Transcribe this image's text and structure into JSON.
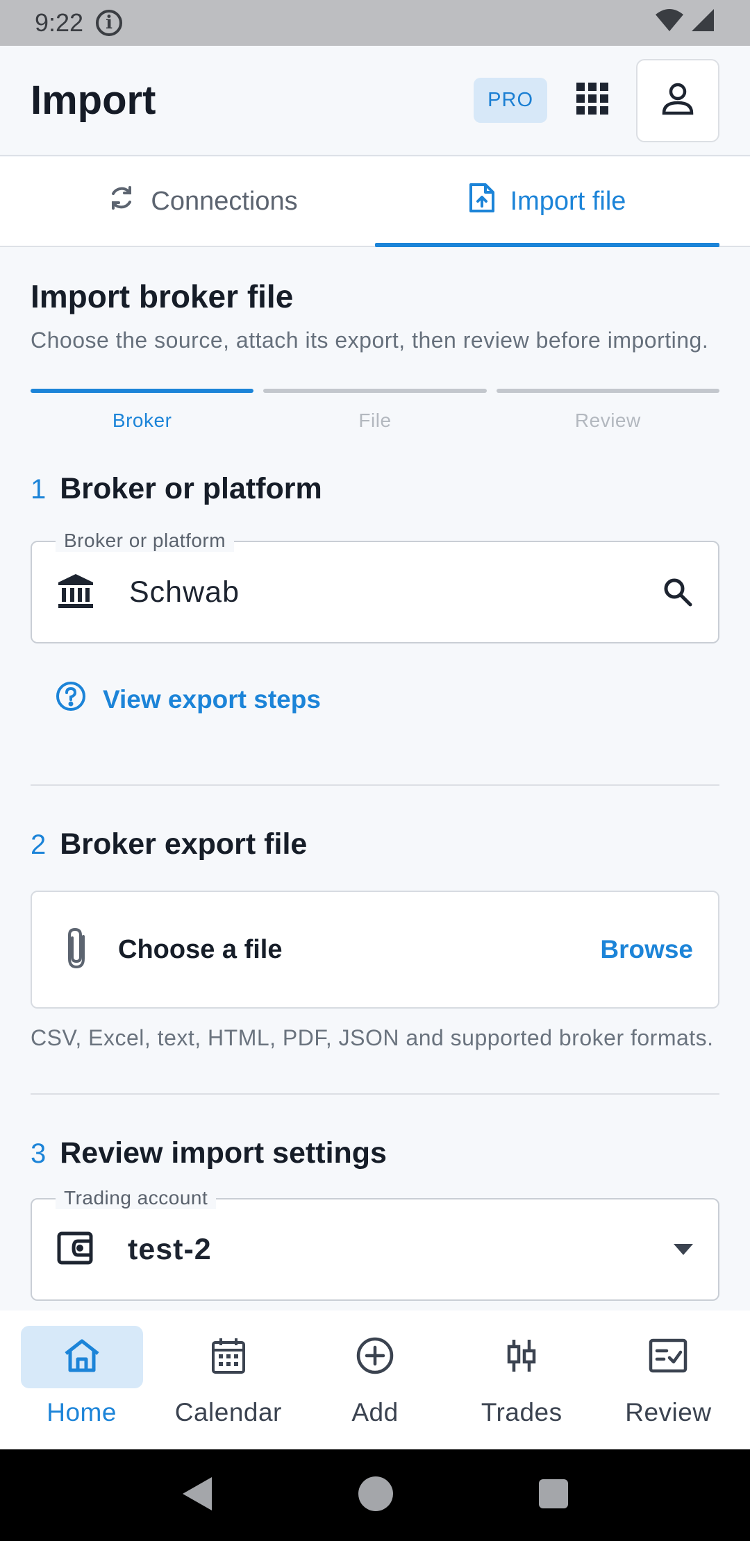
{
  "status_bar": {
    "time": "9:22"
  },
  "header": {
    "title": "Import",
    "pro_badge": "PRO"
  },
  "tabs": [
    {
      "label": "Connections",
      "active": false
    },
    {
      "label": "Import file",
      "active": true
    }
  ],
  "intro": {
    "title": "Import broker file",
    "description": "Choose the source, attach its export, then review before importing."
  },
  "stepper": [
    {
      "label": "Broker",
      "active": true
    },
    {
      "label": "File",
      "active": false
    },
    {
      "label": "Review",
      "active": false
    }
  ],
  "section1": {
    "number": "1",
    "title": "Broker or platform",
    "field_label": "Broker or platform",
    "field_value": "Schwab",
    "link": "View export steps"
  },
  "section2": {
    "number": "2",
    "title": "Broker export file",
    "file_label": "Choose a file",
    "browse": "Browse",
    "hint": "CSV, Excel, text, HTML, PDF, JSON and supported broker formats."
  },
  "section3": {
    "number": "3",
    "title": "Review import settings",
    "field_label": "Trading account",
    "field_value": "test-2"
  },
  "bottom_nav": [
    {
      "label": "Home",
      "icon": "home-icon",
      "active": true
    },
    {
      "label": "Calendar",
      "icon": "calendar-icon",
      "active": false
    },
    {
      "label": "Add",
      "icon": "add-circle-icon",
      "active": false
    },
    {
      "label": "Trades",
      "icon": "candlestick-icon",
      "active": false
    },
    {
      "label": "Review",
      "icon": "review-checklist-icon",
      "active": false
    }
  ],
  "colors": {
    "accent": "#1c84d8",
    "badge_bg": "#d7e8f8",
    "background": "#f6f8fb"
  }
}
